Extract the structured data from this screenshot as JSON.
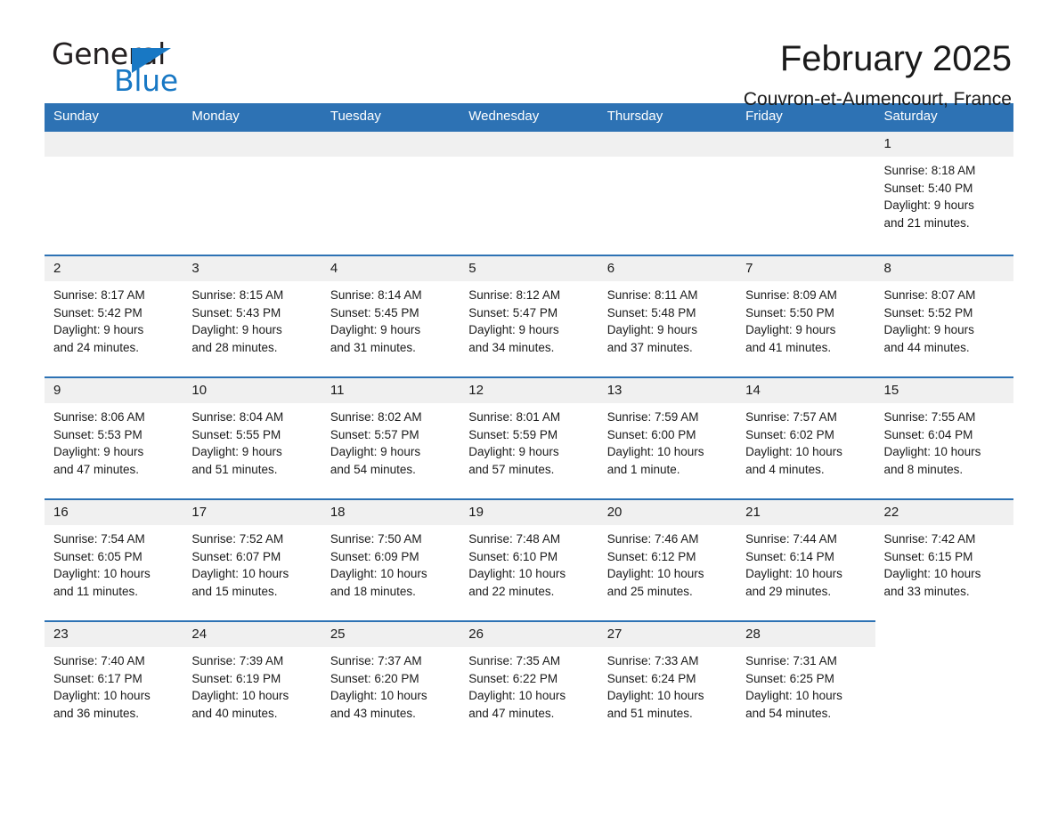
{
  "logo": {
    "text_primary": "General",
    "text_secondary": "Blue",
    "triangle_color": "#1878c4"
  },
  "header": {
    "month_title": "February 2025",
    "location": "Couvron-et-Aumencourt, France"
  },
  "theme": {
    "header_blue": "#2d72b4",
    "daynum_gray": "#f0f0f0",
    "cell_white": "#ffffff"
  },
  "calendar": {
    "weekdays": [
      "Sunday",
      "Monday",
      "Tuesday",
      "Wednesday",
      "Thursday",
      "Friday",
      "Saturday"
    ],
    "weeks": [
      [
        {
          "day": "",
          "blank": true
        },
        {
          "day": "",
          "blank": true
        },
        {
          "day": "",
          "blank": true
        },
        {
          "day": "",
          "blank": true
        },
        {
          "day": "",
          "blank": true
        },
        {
          "day": "",
          "blank": true
        },
        {
          "day": "1",
          "sunrise": "Sunrise: 8:18 AM",
          "sunset": "Sunset: 5:40 PM",
          "daylight_line1": "Daylight: 9 hours",
          "daylight_line2": "and 21 minutes."
        }
      ],
      [
        {
          "day": "2",
          "sunrise": "Sunrise: 8:17 AM",
          "sunset": "Sunset: 5:42 PM",
          "daylight_line1": "Daylight: 9 hours",
          "daylight_line2": "and 24 minutes."
        },
        {
          "day": "3",
          "sunrise": "Sunrise: 8:15 AM",
          "sunset": "Sunset: 5:43 PM",
          "daylight_line1": "Daylight: 9 hours",
          "daylight_line2": "and 28 minutes."
        },
        {
          "day": "4",
          "sunrise": "Sunrise: 8:14 AM",
          "sunset": "Sunset: 5:45 PM",
          "daylight_line1": "Daylight: 9 hours",
          "daylight_line2": "and 31 minutes."
        },
        {
          "day": "5",
          "sunrise": "Sunrise: 8:12 AM",
          "sunset": "Sunset: 5:47 PM",
          "daylight_line1": "Daylight: 9 hours",
          "daylight_line2": "and 34 minutes."
        },
        {
          "day": "6",
          "sunrise": "Sunrise: 8:11 AM",
          "sunset": "Sunset: 5:48 PM",
          "daylight_line1": "Daylight: 9 hours",
          "daylight_line2": "and 37 minutes."
        },
        {
          "day": "7",
          "sunrise": "Sunrise: 8:09 AM",
          "sunset": "Sunset: 5:50 PM",
          "daylight_line1": "Daylight: 9 hours",
          "daylight_line2": "and 41 minutes."
        },
        {
          "day": "8",
          "sunrise": "Sunrise: 8:07 AM",
          "sunset": "Sunset: 5:52 PM",
          "daylight_line1": "Daylight: 9 hours",
          "daylight_line2": "and 44 minutes."
        }
      ],
      [
        {
          "day": "9",
          "sunrise": "Sunrise: 8:06 AM",
          "sunset": "Sunset: 5:53 PM",
          "daylight_line1": "Daylight: 9 hours",
          "daylight_line2": "and 47 minutes."
        },
        {
          "day": "10",
          "sunrise": "Sunrise: 8:04 AM",
          "sunset": "Sunset: 5:55 PM",
          "daylight_line1": "Daylight: 9 hours",
          "daylight_line2": "and 51 minutes."
        },
        {
          "day": "11",
          "sunrise": "Sunrise: 8:02 AM",
          "sunset": "Sunset: 5:57 PM",
          "daylight_line1": "Daylight: 9 hours",
          "daylight_line2": "and 54 minutes."
        },
        {
          "day": "12",
          "sunrise": "Sunrise: 8:01 AM",
          "sunset": "Sunset: 5:59 PM",
          "daylight_line1": "Daylight: 9 hours",
          "daylight_line2": "and 57 minutes."
        },
        {
          "day": "13",
          "sunrise": "Sunrise: 7:59 AM",
          "sunset": "Sunset: 6:00 PM",
          "daylight_line1": "Daylight: 10 hours",
          "daylight_line2": "and 1 minute."
        },
        {
          "day": "14",
          "sunrise": "Sunrise: 7:57 AM",
          "sunset": "Sunset: 6:02 PM",
          "daylight_line1": "Daylight: 10 hours",
          "daylight_line2": "and 4 minutes."
        },
        {
          "day": "15",
          "sunrise": "Sunrise: 7:55 AM",
          "sunset": "Sunset: 6:04 PM",
          "daylight_line1": "Daylight: 10 hours",
          "daylight_line2": "and 8 minutes."
        }
      ],
      [
        {
          "day": "16",
          "sunrise": "Sunrise: 7:54 AM",
          "sunset": "Sunset: 6:05 PM",
          "daylight_line1": "Daylight: 10 hours",
          "daylight_line2": "and 11 minutes."
        },
        {
          "day": "17",
          "sunrise": "Sunrise: 7:52 AM",
          "sunset": "Sunset: 6:07 PM",
          "daylight_line1": "Daylight: 10 hours",
          "daylight_line2": "and 15 minutes."
        },
        {
          "day": "18",
          "sunrise": "Sunrise: 7:50 AM",
          "sunset": "Sunset: 6:09 PM",
          "daylight_line1": "Daylight: 10 hours",
          "daylight_line2": "and 18 minutes."
        },
        {
          "day": "19",
          "sunrise": "Sunrise: 7:48 AM",
          "sunset": "Sunset: 6:10 PM",
          "daylight_line1": "Daylight: 10 hours",
          "daylight_line2": "and 22 minutes."
        },
        {
          "day": "20",
          "sunrise": "Sunrise: 7:46 AM",
          "sunset": "Sunset: 6:12 PM",
          "daylight_line1": "Daylight: 10 hours",
          "daylight_line2": "and 25 minutes."
        },
        {
          "day": "21",
          "sunrise": "Sunrise: 7:44 AM",
          "sunset": "Sunset: 6:14 PM",
          "daylight_line1": "Daylight: 10 hours",
          "daylight_line2": "and 29 minutes."
        },
        {
          "day": "22",
          "sunrise": "Sunrise: 7:42 AM",
          "sunset": "Sunset: 6:15 PM",
          "daylight_line1": "Daylight: 10 hours",
          "daylight_line2": "and 33 minutes."
        }
      ],
      [
        {
          "day": "23",
          "sunrise": "Sunrise: 7:40 AM",
          "sunset": "Sunset: 6:17 PM",
          "daylight_line1": "Daylight: 10 hours",
          "daylight_line2": "and 36 minutes."
        },
        {
          "day": "24",
          "sunrise": "Sunrise: 7:39 AM",
          "sunset": "Sunset: 6:19 PM",
          "daylight_line1": "Daylight: 10 hours",
          "daylight_line2": "and 40 minutes."
        },
        {
          "day": "25",
          "sunrise": "Sunrise: 7:37 AM",
          "sunset": "Sunset: 6:20 PM",
          "daylight_line1": "Daylight: 10 hours",
          "daylight_line2": "and 43 minutes."
        },
        {
          "day": "26",
          "sunrise": "Sunrise: 7:35 AM",
          "sunset": "Sunset: 6:22 PM",
          "daylight_line1": "Daylight: 10 hours",
          "daylight_line2": "and 47 minutes."
        },
        {
          "day": "27",
          "sunrise": "Sunrise: 7:33 AM",
          "sunset": "Sunset: 6:24 PM",
          "daylight_line1": "Daylight: 10 hours",
          "daylight_line2": "and 51 minutes."
        },
        {
          "day": "28",
          "sunrise": "Sunrise: 7:31 AM",
          "sunset": "Sunset: 6:25 PM",
          "daylight_line1": "Daylight: 10 hours",
          "daylight_line2": "and 54 minutes."
        },
        {
          "day": "",
          "trailing_blank": true
        }
      ]
    ]
  }
}
